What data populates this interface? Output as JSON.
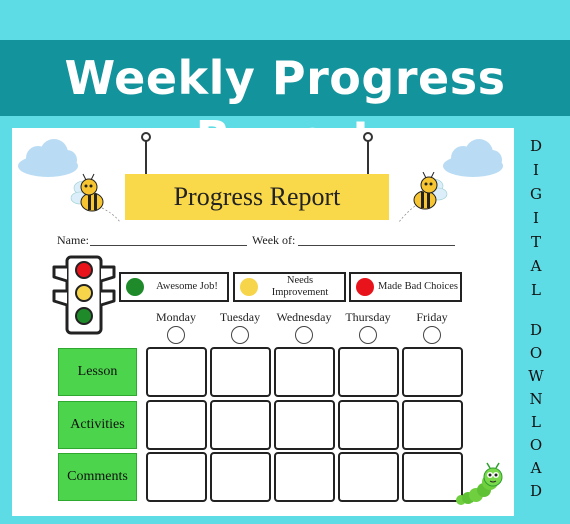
{
  "banner": {
    "title": "Weekly Progress Report"
  },
  "side_text": [
    "D",
    "I",
    "G",
    "I",
    "T",
    "A",
    "L",
    "D",
    "O",
    "W",
    "N",
    "L",
    "O",
    "A",
    "D"
  ],
  "sheet": {
    "title": "Progress Report",
    "name_label": "Name:",
    "week_label": "Week of:",
    "legend": [
      {
        "label": "Awesome Job!",
        "color": "#1f8a2a"
      },
      {
        "label": "Needs Improvement",
        "color": "#f7d54a"
      },
      {
        "label": "Made Bad Choices",
        "color": "#e8131b"
      }
    ],
    "days": [
      "Monday",
      "Tuesday",
      "Wednesday",
      "Thursday",
      "Friday"
    ],
    "rows": [
      "Lesson",
      "Activities",
      "Comments"
    ]
  },
  "colors": {
    "teal_background": "#5ddce5",
    "banner": "#13939c",
    "title_card": "#f9d949",
    "row_label": "#4cd44c"
  },
  "icons": [
    "traffic-light-icon",
    "bee-icon",
    "cloud-icon",
    "caterpillar-icon",
    "hook-icon"
  ]
}
